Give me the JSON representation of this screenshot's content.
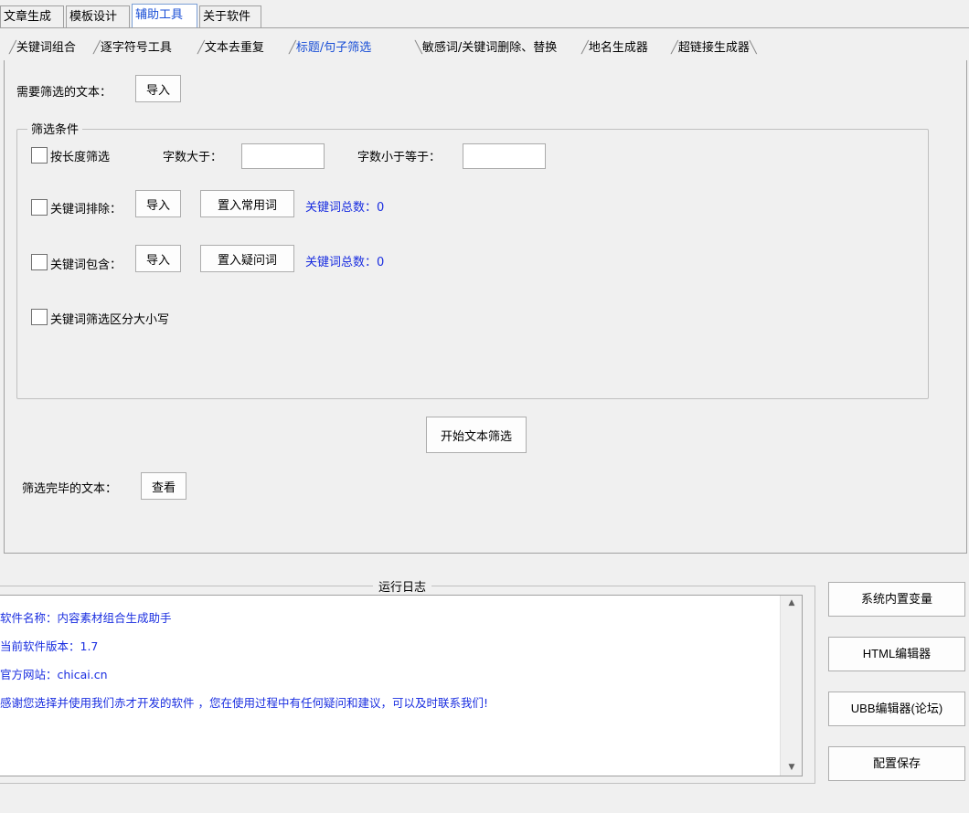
{
  "top_tabs": [
    {
      "label": "文章生成"
    },
    {
      "label": "模板设计"
    },
    {
      "label": "辅助工具"
    },
    {
      "label": "关于软件"
    }
  ],
  "sub_tabs": [
    {
      "label": "关键词组合"
    },
    {
      "label": "逐字符号工具"
    },
    {
      "label": "文本去重复"
    },
    {
      "label": "标题/句子筛选"
    },
    {
      "label": "敏感词/关键词删除、替换"
    },
    {
      "label": "地名生成器"
    },
    {
      "label": "超链接生成器"
    }
  ],
  "main": {
    "source_label": "需要筛选的文本：",
    "import_label": "导入",
    "group_title": "筛选条件",
    "length_filter_label": "按长度筛选",
    "min_chars_label": "字数大于：",
    "max_chars_label": "字数小于等于：",
    "min_chars_value": "",
    "max_chars_value": "",
    "exclude_label": "关键词排除：",
    "exclude_import": "导入",
    "exclude_common": "置入常用词",
    "exclude_count": "关键词总数：0",
    "include_label": "关键词包含：",
    "include_import": "导入",
    "include_question": "置入疑问词",
    "include_count": "关键词总数：0",
    "case_label": "关键词筛选区分大小写",
    "start_button": "开始文本筛选",
    "result_label": "筛选完毕的文本：",
    "view_button": "查看"
  },
  "log": {
    "title": "运行日志",
    "lines": [
      "软件名称：内容素材组合生成助手",
      "当前软件版本：1.7",
      "官方网站：chicai.cn",
      "感谢您选择并使用我们赤才开发的软件 ，您在使用过程中有任何疑问和建议，可以及时联系我们!"
    ]
  },
  "side_buttons": {
    "vars": "系统内置变量",
    "html": "HTML编辑器",
    "ubb": "UBB编辑器(论坛)",
    "save": "配置保存"
  }
}
